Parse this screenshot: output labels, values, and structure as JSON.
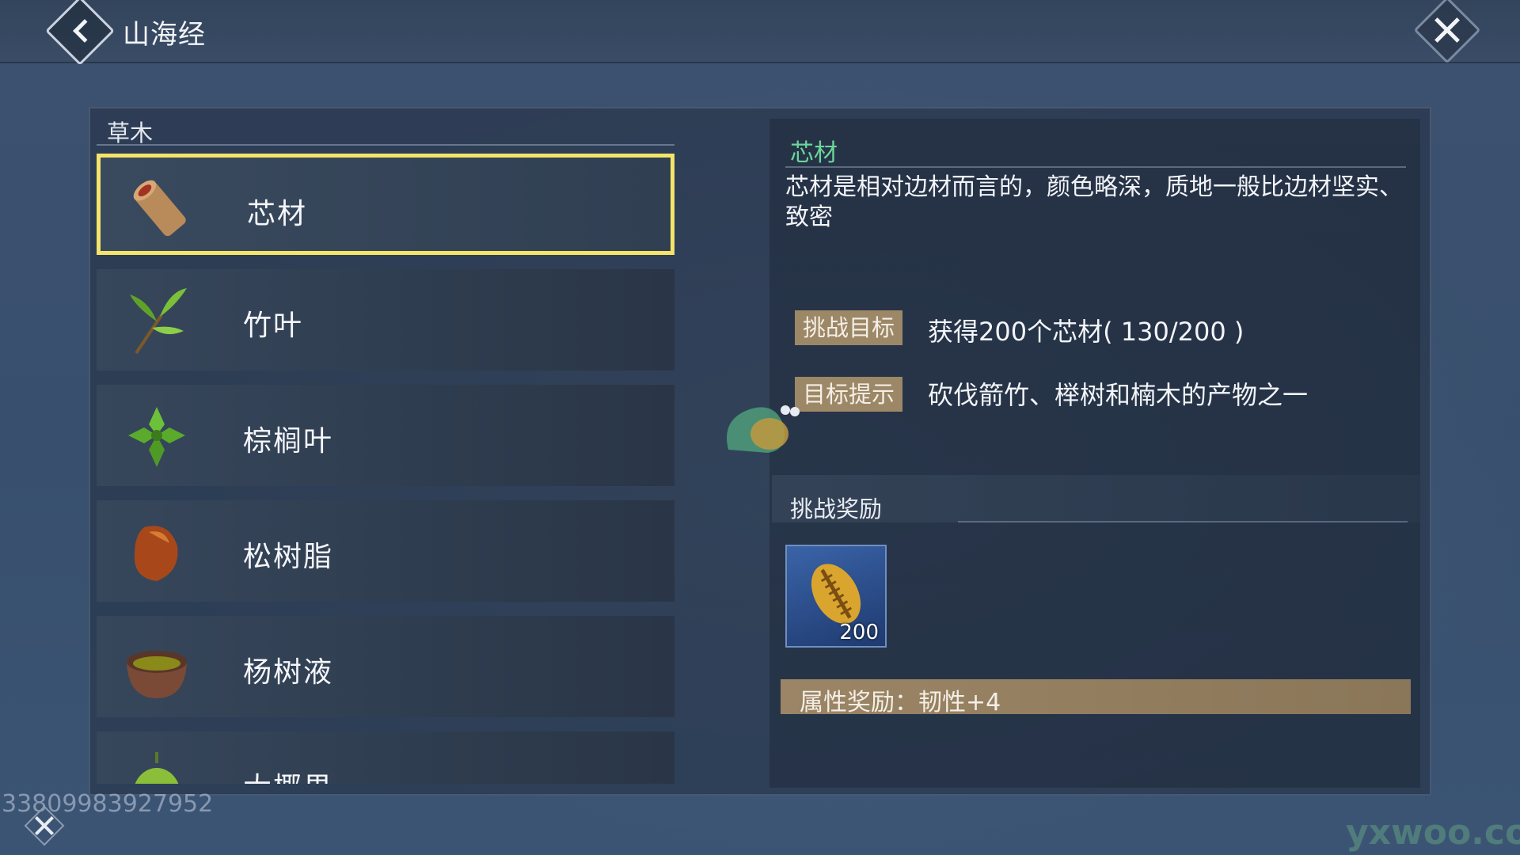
{
  "header": {
    "title": "山海经"
  },
  "list": {
    "category": "草木",
    "items": [
      {
        "label": "芯材",
        "icon": "wood-core-icon",
        "selected": true
      },
      {
        "label": "竹叶",
        "icon": "bamboo-leaf-icon",
        "selected": false
      },
      {
        "label": "棕榈叶",
        "icon": "palm-leaf-icon",
        "selected": false
      },
      {
        "label": "松树脂",
        "icon": "pine-resin-icon",
        "selected": false
      },
      {
        "label": "杨树液",
        "icon": "poplar-sap-bowl-icon",
        "selected": false
      },
      {
        "label": "大椰果",
        "icon": "coconut-icon",
        "selected": false
      }
    ]
  },
  "detail": {
    "title": "芯材",
    "description": "芯材是相对边材而言的，颜色略深，质地一般比边材坚实、致密",
    "challenge_target_label": "挑战目标",
    "challenge_target_value": "获得200个芯材( 130/200 )",
    "hint_label": "目标提示",
    "hint_value": "砍伐箭竹、榉树和楠木的产物之一",
    "reward_title": "挑战奖励",
    "reward_item": {
      "icon": "golden-shell-icon",
      "count": "200"
    },
    "attribute_reward": "属性奖励：韧性+4"
  },
  "footer": {
    "id_text": "33809983927952",
    "watermark": "yxwoo.com"
  },
  "colors": {
    "selected_border": "#f4e46a",
    "title_green": "#6cd59a",
    "tag_bg": "#9c8767",
    "reward_bg": "#2f55a0"
  }
}
